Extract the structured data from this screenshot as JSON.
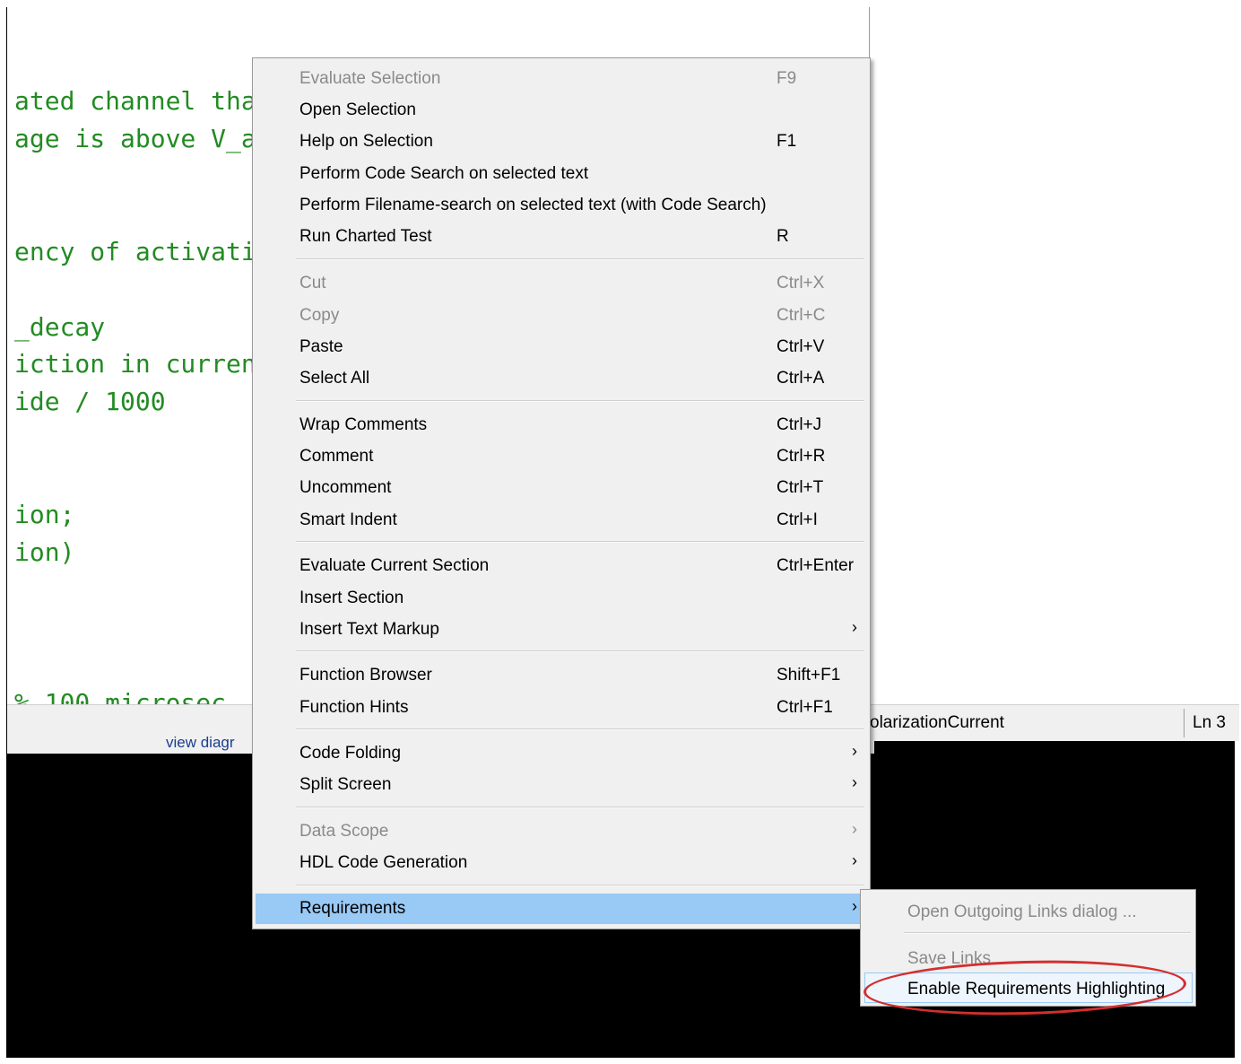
{
  "editor": {
    "code_lines": [
      "ated channel tha",
      "age is above V_a",
      "ency of activati",
      "_decay",
      "iction in curren",
      "ide / 1000",
      "ion;",
      "ion)",
      "% 100 microsec"
    ]
  },
  "status_bar": {
    "function_name": "olarizationCurrent",
    "line_label": "Ln  3"
  },
  "footer": {
    "view_diagram_link": "view diagr"
  },
  "context_menu": {
    "items": [
      {
        "label": "Evaluate Selection",
        "shortcut": "F9",
        "disabled": true
      },
      {
        "label": "Open Selection",
        "shortcut": ""
      },
      {
        "label": "Help on Selection",
        "shortcut": "F1"
      },
      {
        "label": "Perform Code Search on selected text",
        "shortcut": ""
      },
      {
        "label": "Perform Filename-search on selected text (with Code Search)",
        "shortcut": ""
      },
      {
        "label": "Run Charted Test",
        "shortcut": "R"
      },
      {
        "label": "Cut",
        "shortcut": "Ctrl+X",
        "disabled": true
      },
      {
        "label": "Copy",
        "shortcut": "Ctrl+C",
        "disabled": true
      },
      {
        "label": "Paste",
        "shortcut": "Ctrl+V"
      },
      {
        "label": "Select All",
        "shortcut": "Ctrl+A"
      },
      {
        "label": "Wrap Comments",
        "shortcut": "Ctrl+J"
      },
      {
        "label": "Comment",
        "shortcut": "Ctrl+R"
      },
      {
        "label": "Uncomment",
        "shortcut": "Ctrl+T"
      },
      {
        "label": "Smart Indent",
        "shortcut": "Ctrl+I"
      },
      {
        "label": "Evaluate Current Section",
        "shortcut": "Ctrl+Enter"
      },
      {
        "label": "Insert Section",
        "shortcut": ""
      },
      {
        "label": "Insert Text Markup",
        "shortcut": "",
        "submenu": true
      },
      {
        "label": "Function Browser",
        "shortcut": "Shift+F1"
      },
      {
        "label": "Function Hints",
        "shortcut": "Ctrl+F1"
      },
      {
        "label": "Code Folding",
        "shortcut": "",
        "submenu": true
      },
      {
        "label": "Split Screen",
        "shortcut": "",
        "submenu": true
      },
      {
        "label": "Data Scope",
        "shortcut": "",
        "submenu": true,
        "disabled": true
      },
      {
        "label": "HDL Code Generation",
        "shortcut": "",
        "submenu": true
      },
      {
        "label": "Requirements",
        "shortcut": "",
        "submenu": true,
        "highlighted": true
      }
    ],
    "submenu_arrow": "›"
  },
  "requirements_submenu": {
    "items": [
      {
        "label": "Open Outgoing Links dialog ...",
        "disabled": true
      },
      {
        "label": "Save Links",
        "disabled": true
      },
      {
        "label": "Enable Requirements Highlighting",
        "focused": true
      }
    ]
  },
  "colors": {
    "highlight": "#99c9f5",
    "code_green": "#228b22",
    "annotation_red": "#d32f2f"
  }
}
